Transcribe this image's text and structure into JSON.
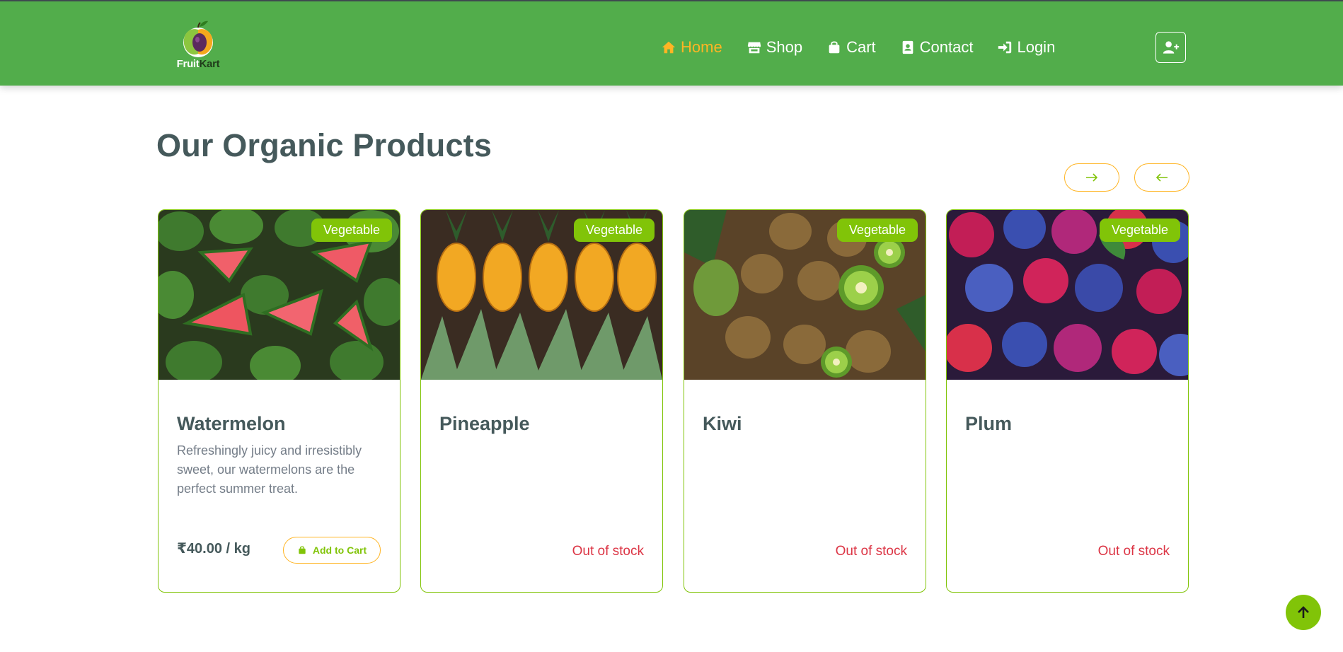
{
  "header": {
    "logo_text_a": "Fruit",
    "logo_text_b": "Kart",
    "nav": [
      {
        "label": "Home",
        "icon": "home-icon",
        "active": true
      },
      {
        "label": "Shop",
        "icon": "store-icon"
      },
      {
        "label": "Cart",
        "icon": "shopping-bag-icon"
      },
      {
        "label": "Contact",
        "icon": "contact-card-icon"
      },
      {
        "label": "Login",
        "icon": "sign-in-icon"
      }
    ],
    "user_button_icon": "user-plus-icon"
  },
  "main": {
    "heading": "Our Organic Products",
    "carousel_next_icon": "arrow-right-icon",
    "carousel_prev_icon": "arrow-left-icon",
    "products": [
      {
        "name": "Watermelon",
        "badge": "Vegetable",
        "description": "Refreshingly juicy and irresistibly sweet, our watermelons are the perfect summer treat.",
        "price": "₹40.00 / kg",
        "cart_label": "Add to Cart",
        "status": ""
      },
      {
        "name": "Pineapple",
        "badge": "Vegetable",
        "description": "",
        "price": "",
        "cart_label": "",
        "status": "Out of stock"
      },
      {
        "name": "Kiwi",
        "badge": "Vegetable",
        "description": "",
        "price": "",
        "cart_label": "",
        "status": "Out of stock"
      },
      {
        "name": "Plum",
        "badge": "Vegetable",
        "description": "",
        "price": "",
        "cart_label": "",
        "status": "Out of stock"
      }
    ]
  },
  "scroll_top_icon": "arrow-up-icon",
  "colors": {
    "header_bg": "#52ad4b",
    "accent_orange": "#ffb524",
    "accent_green": "#81c408",
    "heading": "#45595b",
    "out_of_stock": "#dc3545"
  }
}
